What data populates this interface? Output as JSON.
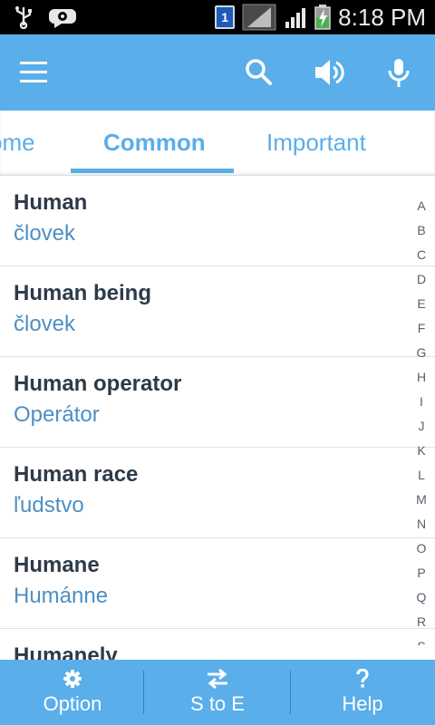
{
  "status_bar": {
    "sim_slot": "1",
    "time": "8:18 PM"
  },
  "app_bar": {
    "icons": [
      "menu-icon",
      "search-icon",
      "speaker-icon",
      "microphone-icon"
    ]
  },
  "tabs": [
    {
      "label": "Home",
      "visible_text": "ome"
    },
    {
      "label": "Common",
      "selected": true
    },
    {
      "label": "Important"
    }
  ],
  "list": [
    {
      "word": "Human",
      "translation": "človek"
    },
    {
      "word": "Human being",
      "translation": "človek"
    },
    {
      "word": "Human operator",
      "translation": "Operátor"
    },
    {
      "word": "Human race",
      "translation": "ľudstvo"
    },
    {
      "word": "Humane",
      "translation": "Humánne"
    },
    {
      "word": "Humanely",
      "translation": ""
    }
  ],
  "alphabet": [
    "A",
    "B",
    "C",
    "D",
    "E",
    "F",
    "G",
    "H",
    "I",
    "J",
    "K",
    "L",
    "M",
    "N",
    "O",
    "P",
    "Q",
    "R",
    "S"
  ],
  "bottom_bar": {
    "option_label": "Option",
    "direction_label": "S to E",
    "help_label": "Help"
  },
  "colors": {
    "accent": "#5aaeea",
    "word_text": "#2d3a48",
    "translation_text": "#4d8fc3"
  }
}
